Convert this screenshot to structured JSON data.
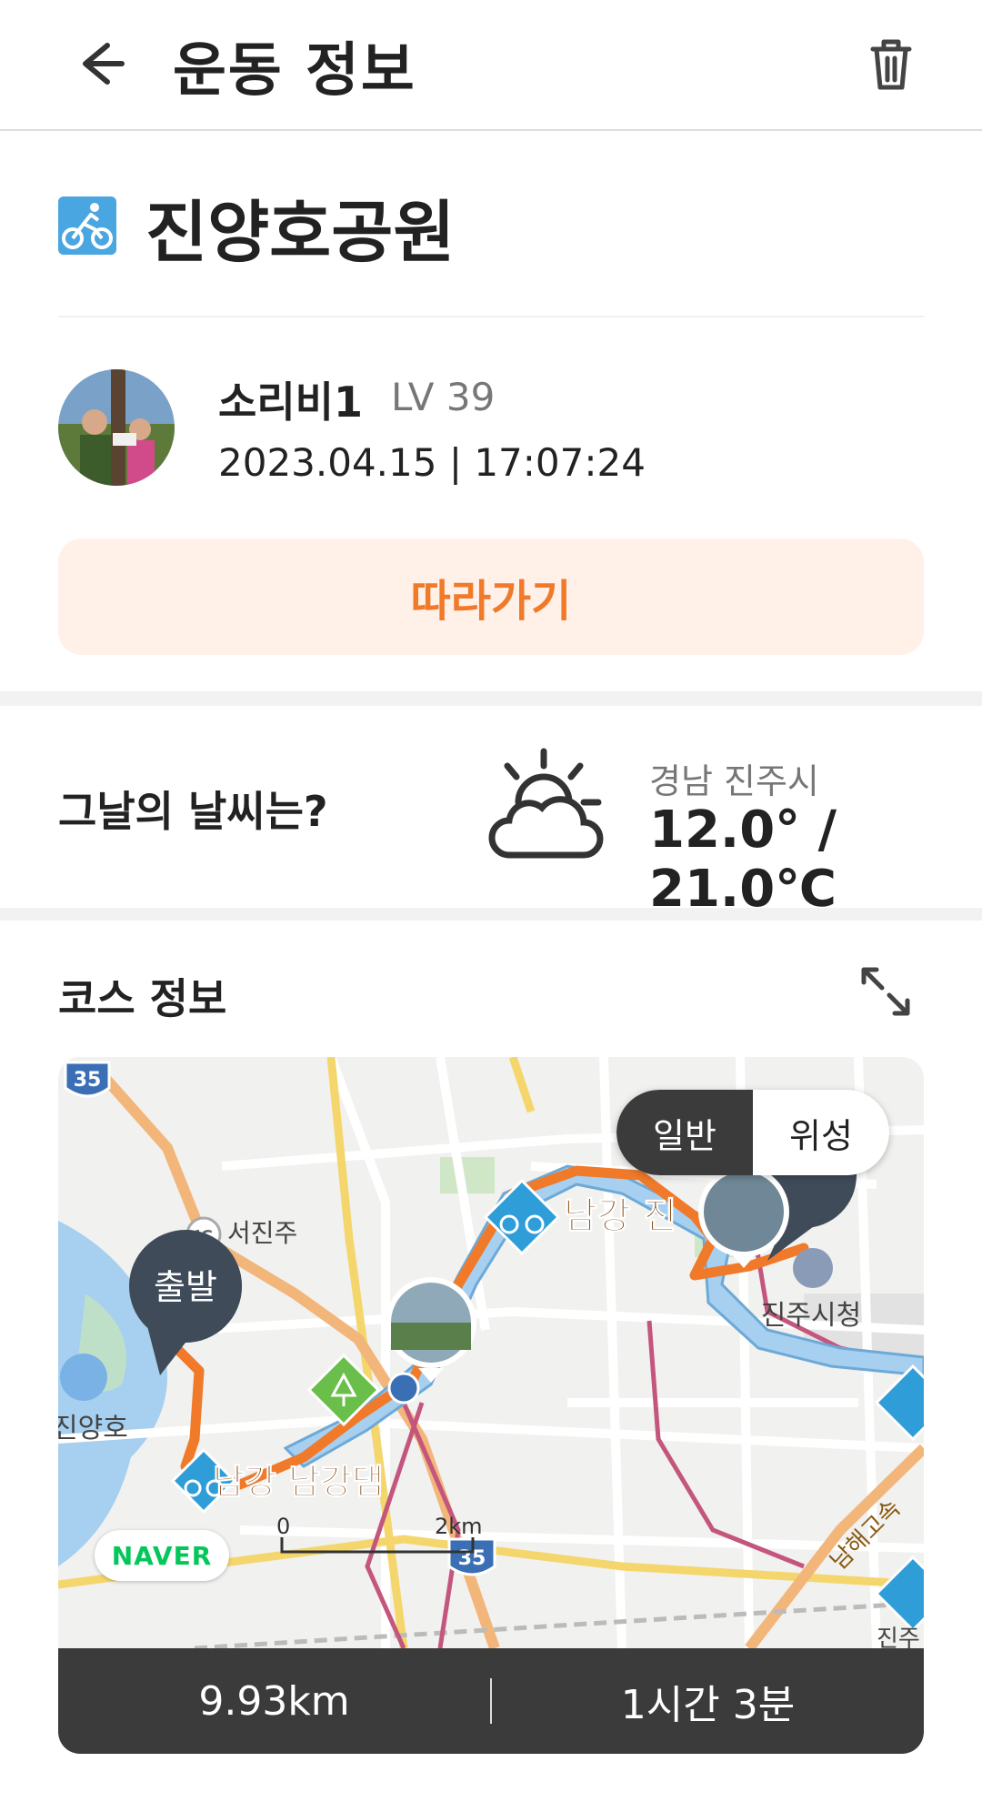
{
  "header": {
    "title": "운동 정보",
    "back_icon": "arrow-left-icon",
    "trash_icon": "trash-icon"
  },
  "activity": {
    "type_icon": "cycling-icon",
    "place": "진양호공원"
  },
  "user": {
    "name": "소리비1",
    "level": "LV 39",
    "datetime": "2023.04.15 | 17:07:24"
  },
  "follow_button": "따라가기",
  "weather": {
    "question": "그날의 날씨는?",
    "icon": "partly-cloudy-icon",
    "region": "경남 진주시",
    "temperature": "12.0° / 21.0℃"
  },
  "course": {
    "title": "코스 정보",
    "expand_icon": "expand-icon",
    "map": {
      "toggle": [
        "일반",
        "위성"
      ],
      "active_toggle": "일반",
      "labels": {
        "start": "출발",
        "seojinju": "서진주",
        "jinyangho": "진양호",
        "namgang_dam": "남강 남강댐",
        "namgang_jin": "남강 진",
        "city_hall": "진주시청",
        "highway": "남해고속",
        "jinju_partial": "진주",
        "route35_top": "35",
        "route35_bottom": "35",
        "ic": "IC",
        "scale_zero": "0",
        "scale_km": "2km"
      },
      "naver": "NAVER"
    },
    "stats": {
      "distance": "9.93km",
      "duration": "1시간 3분"
    }
  },
  "colors": {
    "accent": "#f07a2a",
    "accent_bg": "#fff0e8",
    "dark": "#3b3b3b",
    "route": "#f07a2a",
    "river": "#a6cff0"
  }
}
